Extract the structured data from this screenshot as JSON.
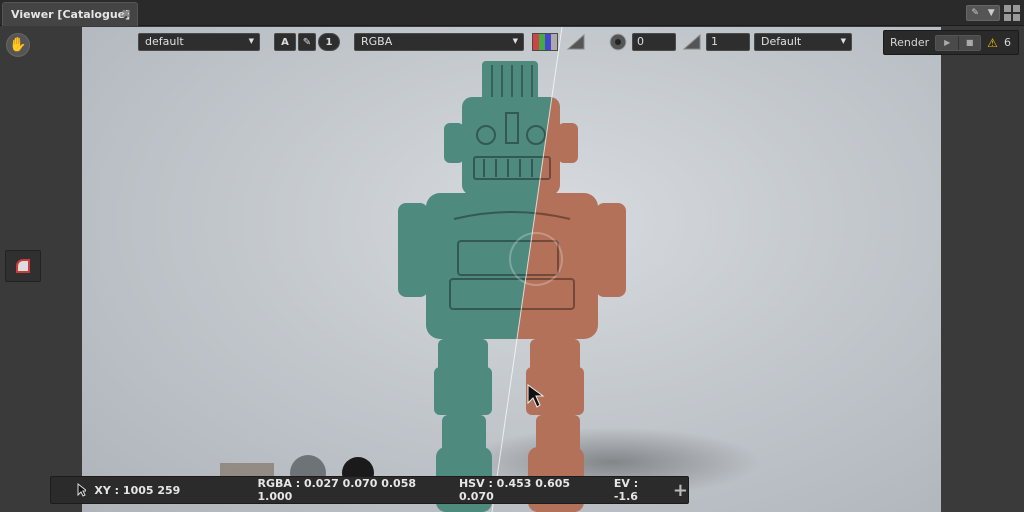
{
  "tab": {
    "title": "Viewer [Catalogue]",
    "close": "✖"
  },
  "toolbar": {
    "view_preset": "default",
    "annotate_label": "A",
    "channel_count": "1",
    "channel_mode": "RGBA",
    "exposure": "0",
    "gamma": "1",
    "lut": "Default"
  },
  "render": {
    "label": "Render",
    "warning_count": "6",
    "play": "▶",
    "stop": "■",
    "warning_icon": "⚠"
  },
  "status": {
    "xy": "XY : 1005 259",
    "rgba": "RGBA : 0.027 0.070 0.058 1.000",
    "hsv": "HSV : 0.453 0.605 0.070",
    "ev": "EV : -1.6",
    "plus": "+"
  },
  "colors": {
    "robot_left": "#4f8a7e",
    "robot_right": "#b3715a",
    "background": "#c3c8cd",
    "warning": "#f0c000"
  },
  "icons": [
    "hand-icon",
    "grid-icon",
    "pin-icon",
    "eyedropper-icon",
    "color-channels-icon",
    "gamma-ramp-icon",
    "aperture-icon",
    "play-icon",
    "stop-icon",
    "warning-icon",
    "cursor-icon"
  ]
}
